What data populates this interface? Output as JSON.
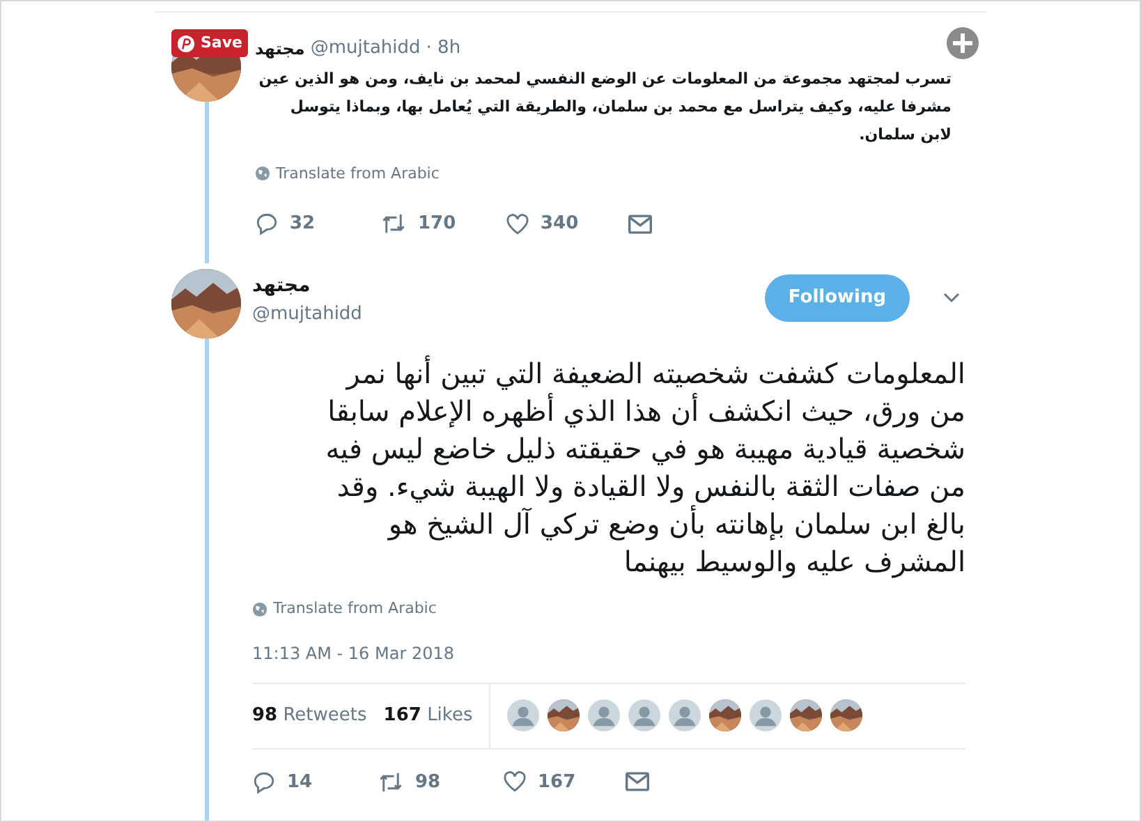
{
  "save_button": {
    "label": "Save"
  },
  "previous_tweet": {
    "name": "مجتهد",
    "handle": "@mujtahidd",
    "time": "· 8h",
    "text": "تسرب لمجتهد مجموعة من المعلومات عن الوضع النفسي لمحمد بن نايف، ومن هو الذين عين مشرفا عليه، وكيف يتراسل مع محمد بن سلمان، والطريقة التي يُعامل بها، وبماذا يتوسل لابن سلمان.",
    "translate": "Translate from Arabic",
    "replies": "32",
    "retweets": "170",
    "likes": "340"
  },
  "tweet": {
    "name": "مجتهد",
    "handle": "@mujtahidd",
    "follow_button": {
      "label": "Following",
      "selected": true
    },
    "text": "المعلومات كشفت شخصيته الضعيفة التي تبين أنها نمر من ورق، حيث انكشف أن هذا الذي أظهره الإعلام سابقا شخصية قيادية مهيبة هو في حقيقته ذليل خاضع ليس فيه من صفات الثقة بالنفس ولا القيادة ولا الهيبة شيء. وقد بالغ ابن سلمان بإهانته بأن وضع تركي آل الشيخ هو المشرف عليه والوسيط بيهنما",
    "translate": "Translate from Arabic",
    "timestamp": "11:13 AM - 16 Mar 2018",
    "retweet_count": "98",
    "retweet_label": "Retweets",
    "like_count": "167",
    "like_label": "Likes",
    "liker_avatars": [
      {
        "kind": "default"
      },
      {
        "kind": "picture"
      },
      {
        "kind": "default"
      },
      {
        "kind": "default"
      },
      {
        "kind": "default"
      },
      {
        "kind": "picture"
      },
      {
        "kind": "default"
      },
      {
        "kind": "picture"
      },
      {
        "kind": "picture"
      }
    ],
    "replies": "14",
    "retweets": "98",
    "likes": "167"
  }
}
